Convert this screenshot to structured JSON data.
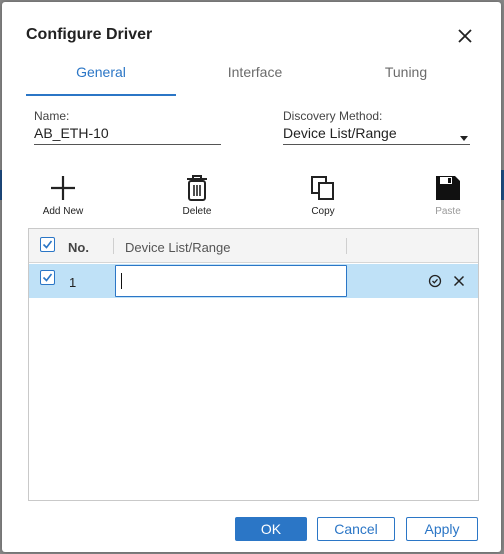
{
  "dialog": {
    "title": "Configure Driver",
    "close_icon": "close-icon"
  },
  "tabs": [
    {
      "label": "General",
      "active": true
    },
    {
      "label": "Interface",
      "active": false
    },
    {
      "label": "Tuning",
      "active": false
    }
  ],
  "form": {
    "name": {
      "label": "Name:",
      "value": "AB_ETH-10"
    },
    "discovery_method": {
      "label": "Discovery Method:",
      "value": "Device List/Range"
    }
  },
  "toolbar": {
    "add": {
      "label": "Add New",
      "icon": "plus-icon",
      "enabled": true
    },
    "delete": {
      "label": "Delete",
      "icon": "trash-icon",
      "enabled": true
    },
    "copy": {
      "label": "Copy",
      "icon": "copy-icon",
      "enabled": true
    },
    "paste": {
      "label": "Paste",
      "icon": "save-icon",
      "enabled": false
    }
  },
  "grid": {
    "columns": [
      "No.",
      "Device List/Range"
    ],
    "header_checked": true,
    "rows": [
      {
        "no": "1",
        "checked": true,
        "value": "",
        "editing": true
      }
    ],
    "row_actions": [
      "confirm-icon",
      "cancel-icon"
    ]
  },
  "buttons": {
    "ok": "OK",
    "cancel": "Cancel",
    "apply": "Apply"
  },
  "colors": {
    "accent": "#2b76c6",
    "selected_row": "#bfe1f7",
    "header_bg": "#f4f4f4"
  }
}
